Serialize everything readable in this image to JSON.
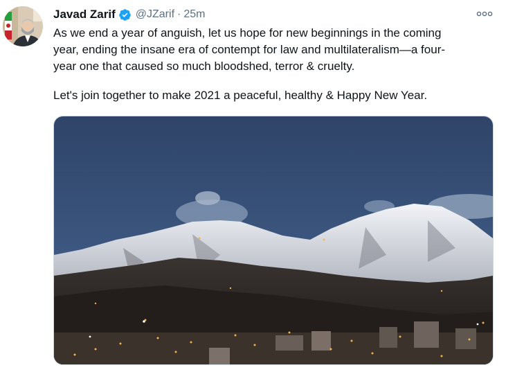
{
  "tweet": {
    "author": {
      "name": "Javad Zarif",
      "handle": "@JZarif",
      "verified": true,
      "avatar_icon": "profile-photo"
    },
    "separator": "·",
    "time": "25m",
    "more_icon": "ellipsis-icon",
    "text_lines": [
      "As we end a year of anguish, let us hope for new beginnings in the coming",
      "year, ending the insane era of contempt for law and multilateralism—a four-",
      "year one that caused so much bloodshed, terror & cruelty."
    ],
    "text_line_2": "Let's join together to make 2021 a peaceful, healthy & Happy New Year.",
    "media": {
      "type": "photo"
    }
  },
  "colors": {
    "primary_text": "#0f1419",
    "secondary_text": "#5b7083",
    "verified_blue": "#1da1f2",
    "border": "#cfd9de"
  }
}
